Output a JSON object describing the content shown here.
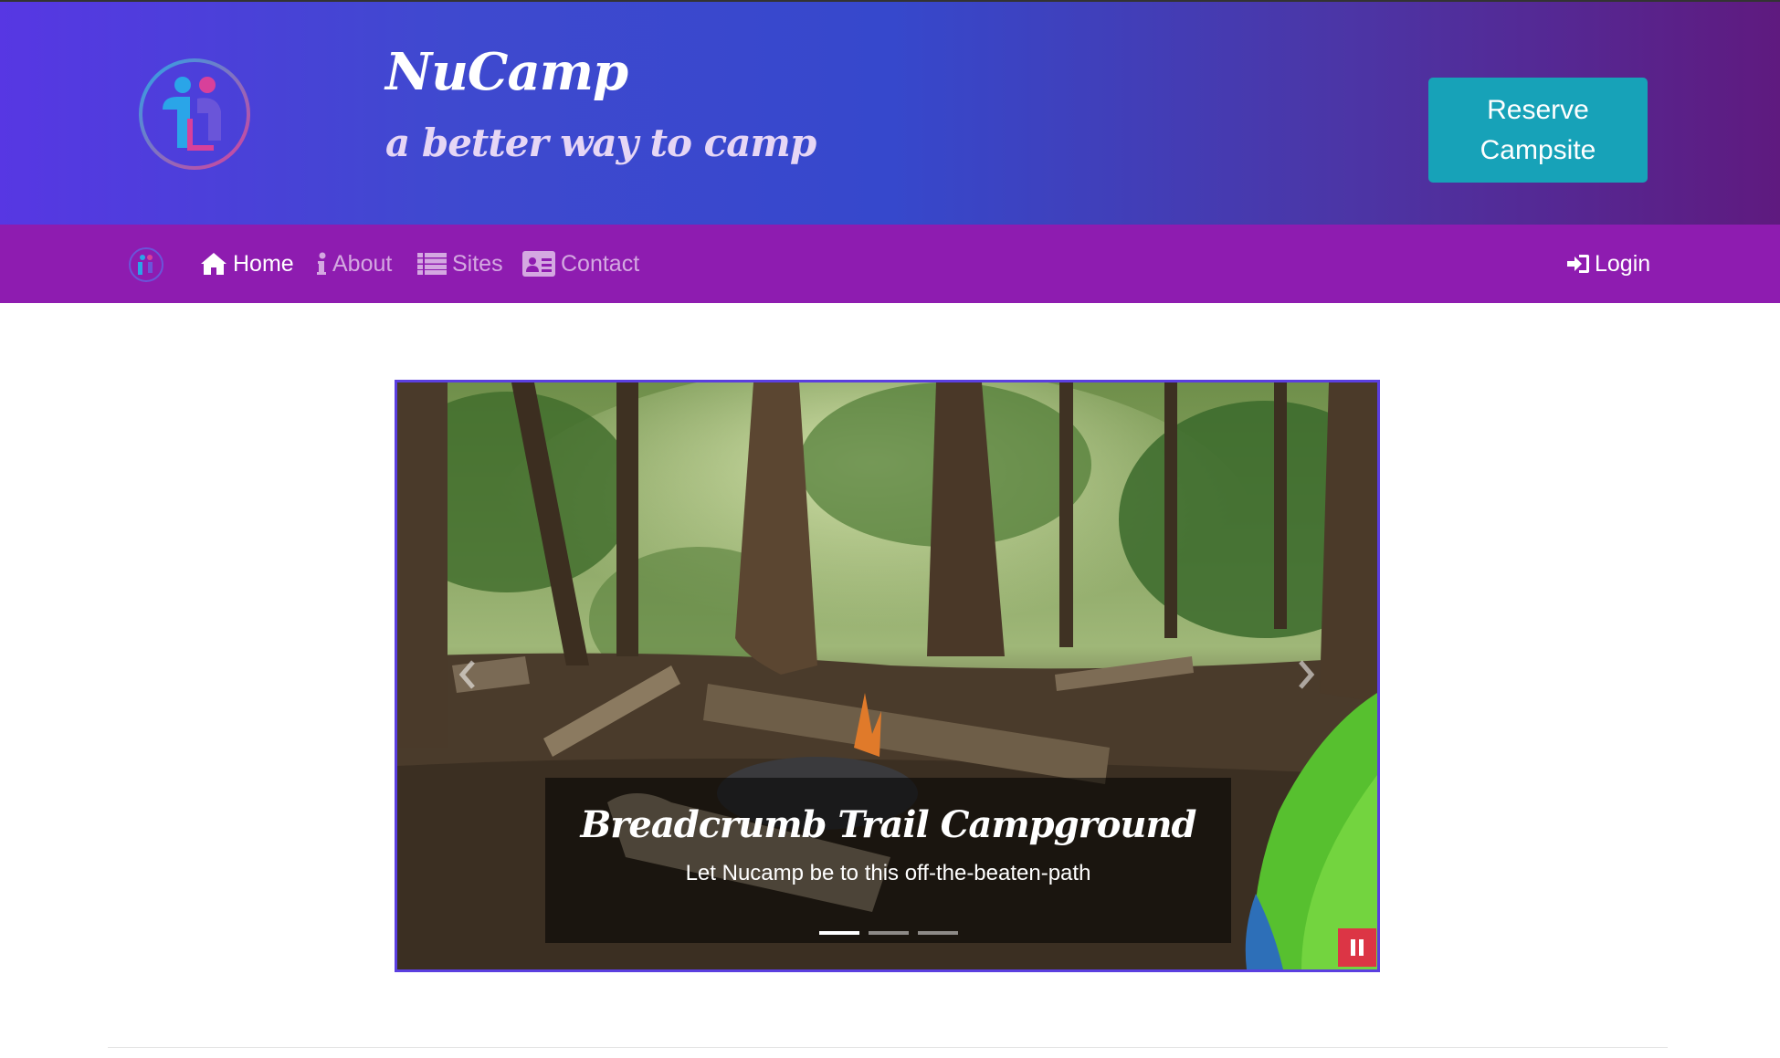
{
  "header": {
    "brand_title": "NuCamp",
    "tagline": "a better way to camp",
    "reserve_button": "Reserve Campsite",
    "logo_icon": "nucamp-logo-icon",
    "gradient_colors": [
      "#5737e3",
      "#3648cc",
      "#5f1a7f"
    ]
  },
  "navbar": {
    "background": "#8e1cb0",
    "items": [
      {
        "label": "Home",
        "icon": "home-icon",
        "active": true
      },
      {
        "label": "About",
        "icon": "info-icon",
        "active": false
      },
      {
        "label": "Sites",
        "icon": "list-icon",
        "active": false
      },
      {
        "label": "Contact",
        "icon": "address-card-icon",
        "active": false
      }
    ],
    "login": {
      "label": "Login",
      "icon": "sign-in-icon"
    }
  },
  "carousel": {
    "caption_title": "Breadcrumb Trail Campground",
    "caption_text": "Let Nucamp be to this off-the-beaten-path",
    "indicators": [
      true,
      false,
      false
    ],
    "pause_color": "#dc3545",
    "border_color": "#5b3fe0"
  },
  "colors": {
    "reserve_button": "#17a2b8"
  }
}
